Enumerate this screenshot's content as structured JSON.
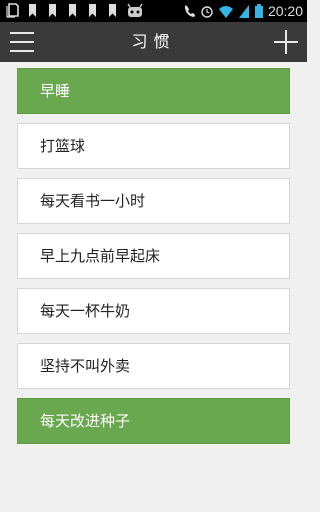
{
  "status_bar": {
    "time": "20:20",
    "left_icons": [
      "notification-icon",
      "bookmark-icon",
      "bookmark-icon",
      "bookmark-icon",
      "bookmark-icon",
      "bookmark-icon",
      "android-icon"
    ],
    "right_icons": [
      "phone-icon",
      "alarm-icon",
      "wifi-icon",
      "signal-icon",
      "battery-icon"
    ]
  },
  "toolbar": {
    "title": "习惯",
    "menu_icon": "hamburger-menu-icon",
    "add_icon": "plus-icon"
  },
  "habits": [
    {
      "label": "早睡",
      "completed": true
    },
    {
      "label": "打篮球",
      "completed": false
    },
    {
      "label": "每天看书一小时",
      "completed": false
    },
    {
      "label": "早上九点前早起床",
      "completed": false
    },
    {
      "label": "每天一杯牛奶",
      "completed": false
    },
    {
      "label": "坚持不叫外卖",
      "completed": false
    },
    {
      "label": "每天改进种子",
      "completed": true
    }
  ],
  "colors": {
    "completed": "#6aa84f",
    "toolbar": "#3a3a3a",
    "background": "#f0f0f0"
  }
}
